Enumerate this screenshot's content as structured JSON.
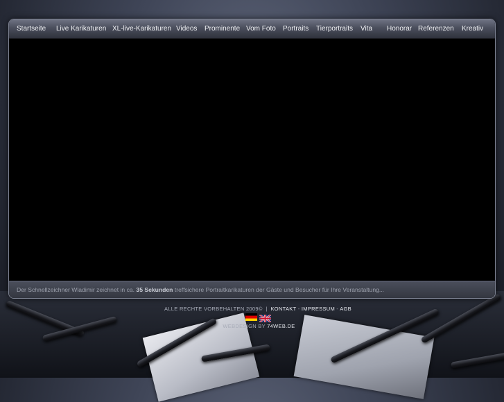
{
  "nav": {
    "items": [
      {
        "label": "Startseite"
      },
      {
        "label": "Live Karikaturen"
      },
      {
        "label": "XL-live-Karikaturen"
      },
      {
        "label": "Videos"
      },
      {
        "label": "Prominente"
      },
      {
        "label": "Vom Foto"
      },
      {
        "label": "Portraits"
      },
      {
        "label": "Tierportraits"
      },
      {
        "label": "Vita"
      },
      {
        "label": "Honorar"
      },
      {
        "label": "Referenzen"
      },
      {
        "label": "Kreativ"
      }
    ]
  },
  "caption": {
    "before": "Der Schnellzeichner Wladimir zeichnet in ca. ",
    "highlight": "35 Sekunden",
    "after": " treffsichere Portraitkarikaturen der Gäste und Besucher für Ihre Veranstaltung..."
  },
  "footer": {
    "rights": "ALLE RECHTE VORBEHALTEN 2009©",
    "divider": "|",
    "kontakt": "KONTAKT",
    "dash": "-",
    "impressum": "IMPRESSUM",
    "agb": "AGB",
    "webdesign_prefix": "WEBDESIGN BY",
    "webdesign_link": "74WEB.DE"
  },
  "flags": {
    "german": "german-flag-icon",
    "english": "uk-flag-icon"
  },
  "colors": {
    "nav_text": "#f1f2f5",
    "caption_text": "#9da1ad",
    "footer_text": "#a8acb8",
    "footer_link": "#e4e6ec"
  }
}
